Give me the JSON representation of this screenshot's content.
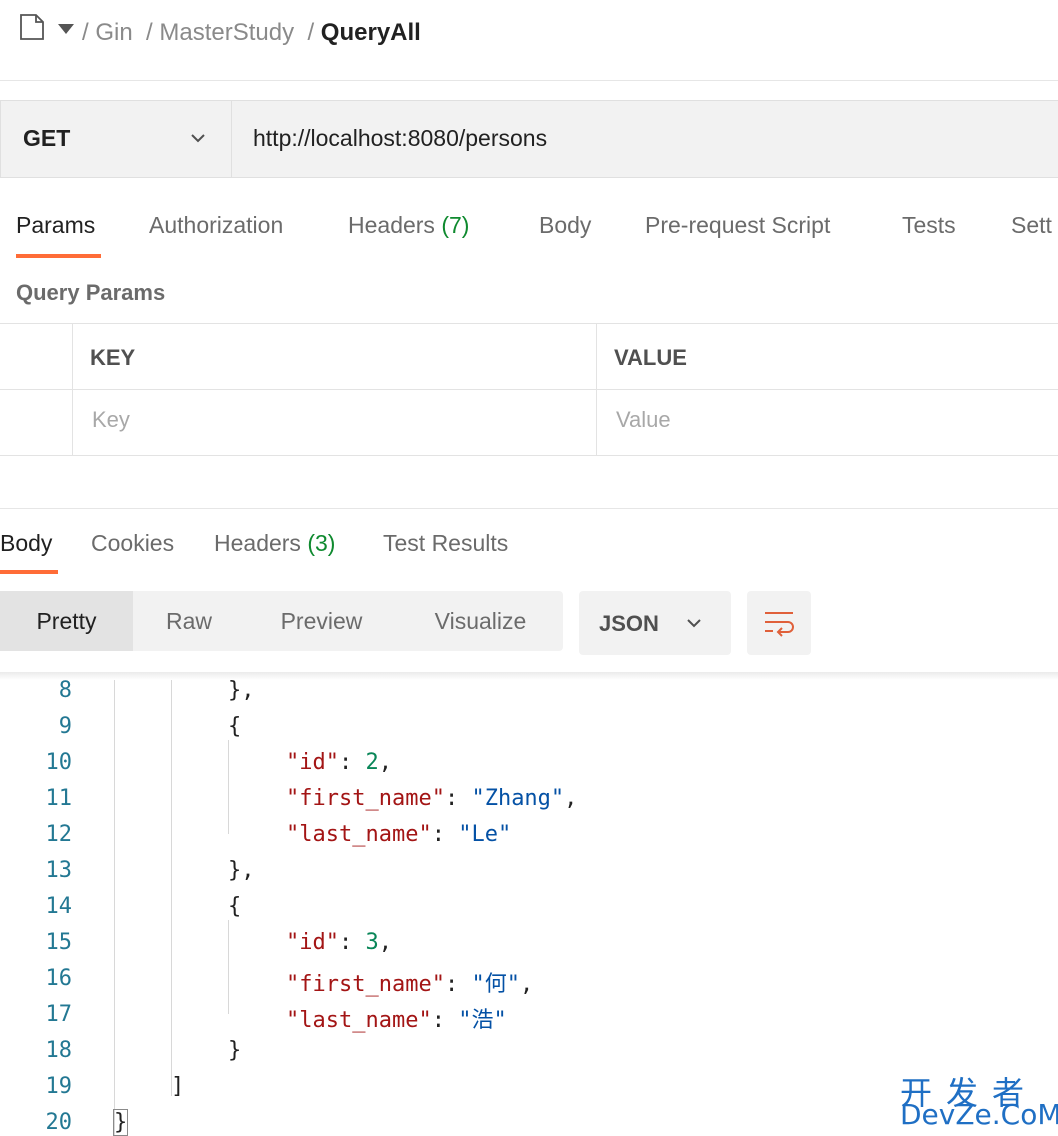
{
  "breadcrumb": {
    "items": [
      "Gin",
      "MasterStudy"
    ],
    "current": "QueryAll"
  },
  "request": {
    "method": "GET",
    "url": "http://localhost:8080/persons"
  },
  "request_tabs": [
    {
      "label": "Params",
      "count": "",
      "active": true
    },
    {
      "label": "Authorization",
      "count": ""
    },
    {
      "label": "Headers",
      "count": "(7)"
    },
    {
      "label": "Body",
      "count": ""
    },
    {
      "label": "Pre-request Script",
      "count": ""
    },
    {
      "label": "Tests",
      "count": ""
    },
    {
      "label": "Sett",
      "count": ""
    }
  ],
  "query_params": {
    "title": "Query Params",
    "columns": [
      "KEY",
      "VALUE"
    ],
    "placeholders": {
      "key": "Key",
      "value": "Value"
    }
  },
  "response_tabs": [
    {
      "label": "Body",
      "count": "",
      "active": true
    },
    {
      "label": "Cookies",
      "count": ""
    },
    {
      "label": "Headers",
      "count": "(3)"
    },
    {
      "label": "Test Results",
      "count": ""
    }
  ],
  "format_modes": [
    "Pretty",
    "Raw",
    "Preview",
    "Visualize"
  ],
  "format_active": "Pretty",
  "language": "JSON",
  "code_lines": [
    {
      "n": "8",
      "text": "},"
    },
    {
      "n": "9",
      "text": "{"
    },
    {
      "n": "10",
      "key": "\"id\"",
      "num": "2",
      "trail": ","
    },
    {
      "n": "11",
      "key": "\"first_name\"",
      "str": "\"Zhang\"",
      "trail": ","
    },
    {
      "n": "12",
      "key": "\"last_name\"",
      "str": "\"Le\"",
      "trail": ""
    },
    {
      "n": "13",
      "text": "},"
    },
    {
      "n": "14",
      "text": "{"
    },
    {
      "n": "15",
      "key": "\"id\"",
      "num": "3",
      "trail": ","
    },
    {
      "n": "16",
      "key": "\"first_name\"",
      "str": "\"何\"",
      "trail": ","
    },
    {
      "n": "17",
      "key": "\"last_name\"",
      "str": "\"浩\"",
      "trail": ""
    },
    {
      "n": "18",
      "text": "}"
    },
    {
      "n": "19",
      "text": "]"
    },
    {
      "n": "20",
      "text": "}"
    }
  ],
  "watermark": {
    "line1": "开发者",
    "line2": "DevZe.CoM"
  },
  "colors": {
    "accent": "#ff6c37",
    "count_green": "#0f8a2f",
    "json_key": "#a31515",
    "json_string": "#0451a5",
    "json_number": "#098658",
    "line_number": "#237893"
  }
}
